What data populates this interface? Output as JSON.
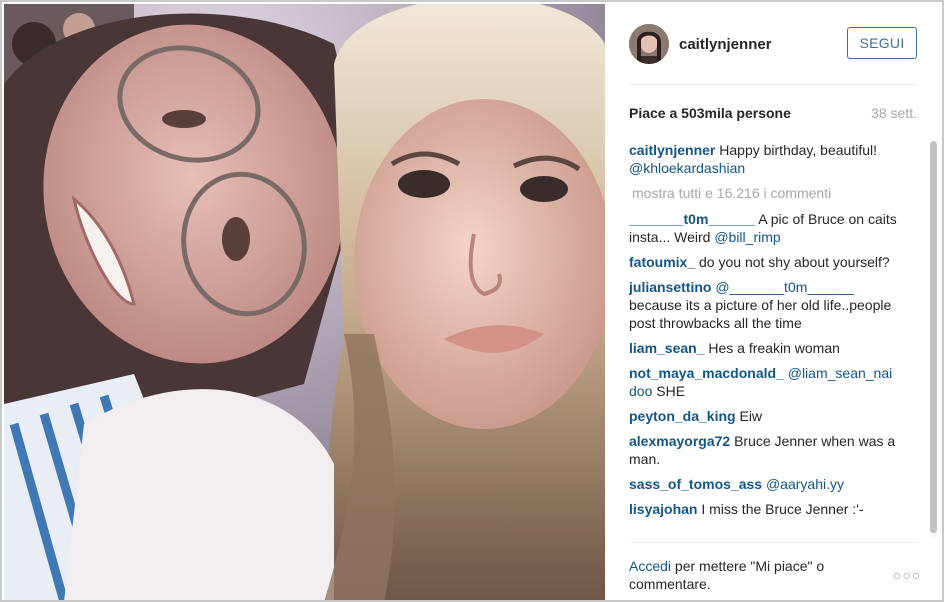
{
  "post": {
    "username": "caitlynjenner",
    "follow_label": "SEGUI",
    "likes": "Piace a 503mila persone",
    "time_ago": "38 sett.",
    "show_all_comments": "mostra tutti e 16.216 i commenti",
    "login_link": "Accedi",
    "login_rest": " per mettere \"Mi piace\" o commentare.",
    "more_icon": "more-options-icon"
  },
  "comments": [
    {
      "user": "caitlynjenner",
      "text": " Happy birthday, beautiful! ",
      "mention": "@khloekardashian",
      "text2": ""
    },
    {
      "user": "_______t0m______",
      "text": " A pic of Bruce on caits insta... Weird ",
      "mention": "@bill_rimp",
      "text2": ""
    },
    {
      "user": "fatoumix_",
      "text": " do you not shy about yourself?",
      "mention": "",
      "text2": ""
    },
    {
      "user": "juliansettino",
      "text": " ",
      "mention": "@_______t0m______",
      "text2": " because its a picture of her old life..people post throwbacks all the time"
    },
    {
      "user": "liam_sean_",
      "text": " Hes a freakin woman",
      "mention": "",
      "text2": ""
    },
    {
      "user": "not_maya_macdonald_",
      "text": " ",
      "mention": "@liam_sean_nai doo",
      "text2": " SHE"
    },
    {
      "user": "peyton_da_king",
      "text": " Eiw",
      "mention": "",
      "text2": ""
    },
    {
      "user": "alexmayorga72",
      "text": " Bruce Jenner when was a man.",
      "mention": "",
      "text2": ""
    },
    {
      "user": "sass_of_tomos_ass",
      "text": " ",
      "mention": "@aaryahi.yy",
      "text2": ""
    },
    {
      "user": "lisyajohan",
      "text": " I miss the Bruce Jenner :'-",
      "mention": "",
      "text2": ""
    }
  ],
  "colors": {
    "link": "#125688",
    "follow": "#3f729b",
    "muted": "#a5a7aa"
  }
}
